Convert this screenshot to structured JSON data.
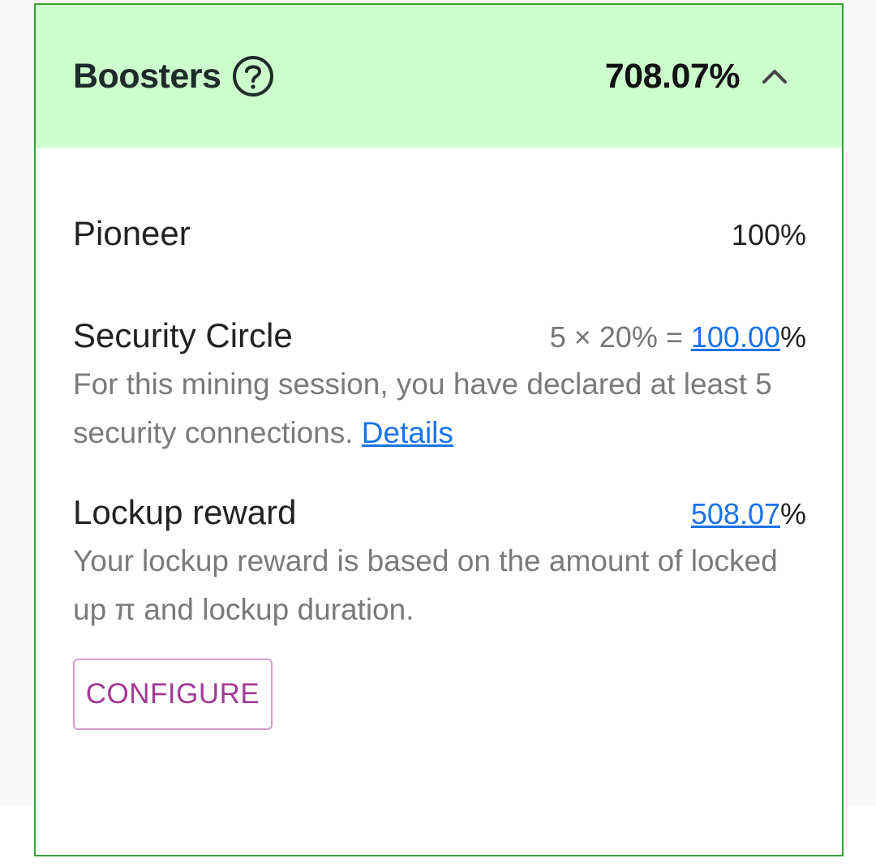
{
  "header": {
    "title": "Boosters",
    "total": "708.07%",
    "help_icon": "question-circle-icon",
    "toggle_icon": "chevron-up-icon"
  },
  "pioneer": {
    "label": "Pioneer",
    "value": "100%"
  },
  "security": {
    "label": "Security Circle",
    "formula": "5 × 20% = ",
    "value_link": "100.00",
    "suffix": "%",
    "description": "For this mining session, you have declared at least 5 security connections. ",
    "details_link": "Details"
  },
  "lockup": {
    "label": "Lockup reward",
    "value_link": "508.07",
    "suffix": "%",
    "description": "Your lockup reward is based on the amount of locked up π and lockup duration.",
    "configure_label": "CONFIGURE"
  },
  "colors": {
    "header_bg": "#ccffcc",
    "border": "#36a336",
    "link": "#1a73e8",
    "button": "#a33a96"
  }
}
